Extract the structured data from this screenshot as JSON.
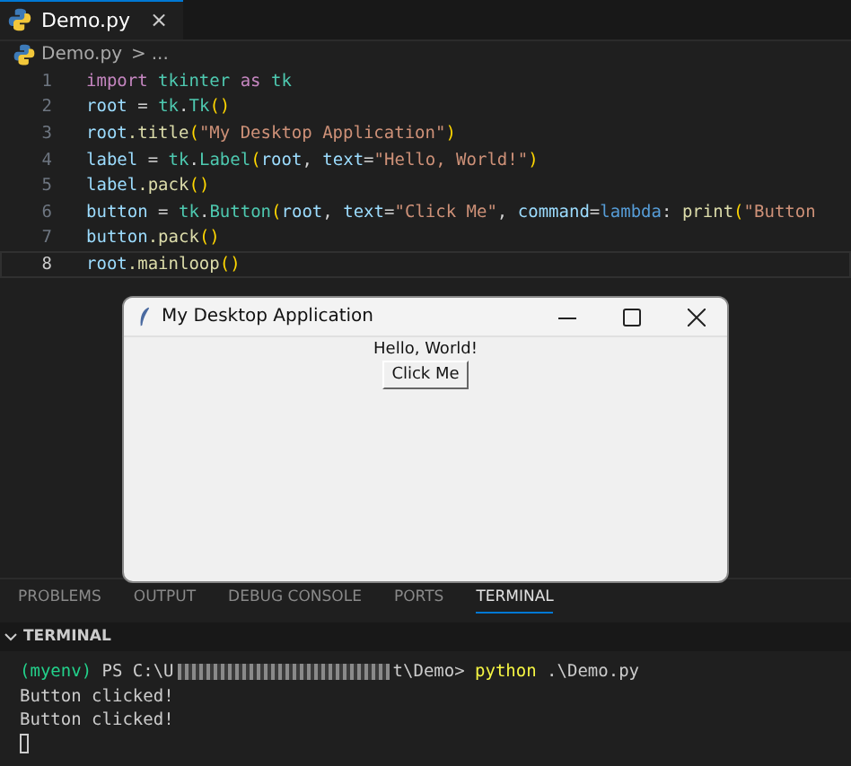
{
  "editor_tabs": [
    {
      "label": "Demo.py",
      "selected": true,
      "close": "×"
    }
  ],
  "breadcrumb": {
    "file": "Demo.py",
    "separator": ">",
    "rest": "..."
  },
  "code": {
    "lines": [
      {
        "number": "1",
        "current": false,
        "tokens": [
          {
            "text": "import ",
            "kind": "keyword"
          },
          {
            "text": "tkinter ",
            "kind": "module"
          },
          {
            "text": "as ",
            "kind": "keyword"
          },
          {
            "text": "tk",
            "kind": "module"
          }
        ]
      },
      {
        "number": "2",
        "current": false,
        "tokens": [
          {
            "text": "root",
            "kind": "variable"
          },
          {
            "text": " = ",
            "kind": "plain"
          },
          {
            "text": "tk",
            "kind": "module"
          },
          {
            "text": ".",
            "kind": "plain"
          },
          {
            "text": "Tk",
            "kind": "module"
          },
          {
            "text": "()",
            "kind": "bracket"
          }
        ]
      },
      {
        "number": "3",
        "current": false,
        "tokens": [
          {
            "text": "root",
            "kind": "variable"
          },
          {
            "text": ".title",
            "kind": "function"
          },
          {
            "text": "(",
            "kind": "bracket"
          },
          {
            "text": "\"My Desktop Application\"",
            "kind": "string"
          },
          {
            "text": ")",
            "kind": "bracket"
          }
        ]
      },
      {
        "number": "4",
        "current": false,
        "tokens": [
          {
            "text": "label",
            "kind": "variable"
          },
          {
            "text": " = ",
            "kind": "plain"
          },
          {
            "text": "tk",
            "kind": "module"
          },
          {
            "text": ".",
            "kind": "plain"
          },
          {
            "text": "Label",
            "kind": "module"
          },
          {
            "text": "(",
            "kind": "bracket"
          },
          {
            "text": "root",
            "kind": "variable"
          },
          {
            "text": ", ",
            "kind": "plain"
          },
          {
            "text": "text",
            "kind": "variable"
          },
          {
            "text": "=",
            "kind": "plain"
          },
          {
            "text": "\"Hello, World!\"",
            "kind": "string"
          },
          {
            "text": ")",
            "kind": "bracket"
          }
        ]
      },
      {
        "number": "5",
        "current": false,
        "tokens": [
          {
            "text": "label",
            "kind": "variable"
          },
          {
            "text": ".pack",
            "kind": "function"
          },
          {
            "text": "()",
            "kind": "bracket"
          }
        ]
      },
      {
        "number": "6",
        "current": false,
        "tokens": [
          {
            "text": "button",
            "kind": "variable"
          },
          {
            "text": " = ",
            "kind": "plain"
          },
          {
            "text": "tk",
            "kind": "module"
          },
          {
            "text": ".",
            "kind": "plain"
          },
          {
            "text": "Button",
            "kind": "module"
          },
          {
            "text": "(",
            "kind": "bracket"
          },
          {
            "text": "root",
            "kind": "variable"
          },
          {
            "text": ", ",
            "kind": "plain"
          },
          {
            "text": "text",
            "kind": "variable"
          },
          {
            "text": "=",
            "kind": "plain"
          },
          {
            "text": "\"Click Me\"",
            "kind": "string"
          },
          {
            "text": ", ",
            "kind": "plain"
          },
          {
            "text": "command",
            "kind": "variable"
          },
          {
            "text": "=",
            "kind": "plain"
          },
          {
            "text": "lambda",
            "kind": "storage"
          },
          {
            "text": ": ",
            "kind": "plain"
          },
          {
            "text": "print",
            "kind": "function"
          },
          {
            "text": "(",
            "kind": "bracket"
          },
          {
            "text": "\"Button",
            "kind": "string"
          }
        ]
      },
      {
        "number": "7",
        "current": false,
        "tokens": [
          {
            "text": "button",
            "kind": "variable"
          },
          {
            "text": ".pack",
            "kind": "function"
          },
          {
            "text": "()",
            "kind": "bracket"
          }
        ]
      },
      {
        "number": "8",
        "current": true,
        "tokens": [
          {
            "text": "root",
            "kind": "variable"
          },
          {
            "text": ".mainloop",
            "kind": "function"
          },
          {
            "text": "()",
            "kind": "bracket"
          }
        ]
      }
    ]
  },
  "app_window": {
    "title": "My Desktop Application",
    "label": "Hello, World!",
    "button": "Click Me"
  },
  "panel_tabs": [
    {
      "label": "PROBLEMS",
      "selected": false
    },
    {
      "label": "OUTPUT",
      "selected": false
    },
    {
      "label": "DEBUG CONSOLE",
      "selected": false
    },
    {
      "label": "PORTS",
      "selected": false
    },
    {
      "label": "TERMINAL",
      "selected": true
    }
  ],
  "terminal": {
    "header": "TERMINAL",
    "expanded": true,
    "prompt": {
      "env": "(myenv)",
      "path_start": "PS C:\\U",
      "path_end": "t\\Demo>",
      "command": "python",
      "argument": ".\\Demo.py"
    },
    "output": [
      "Button clicked!",
      "Button clicked!"
    ]
  }
}
